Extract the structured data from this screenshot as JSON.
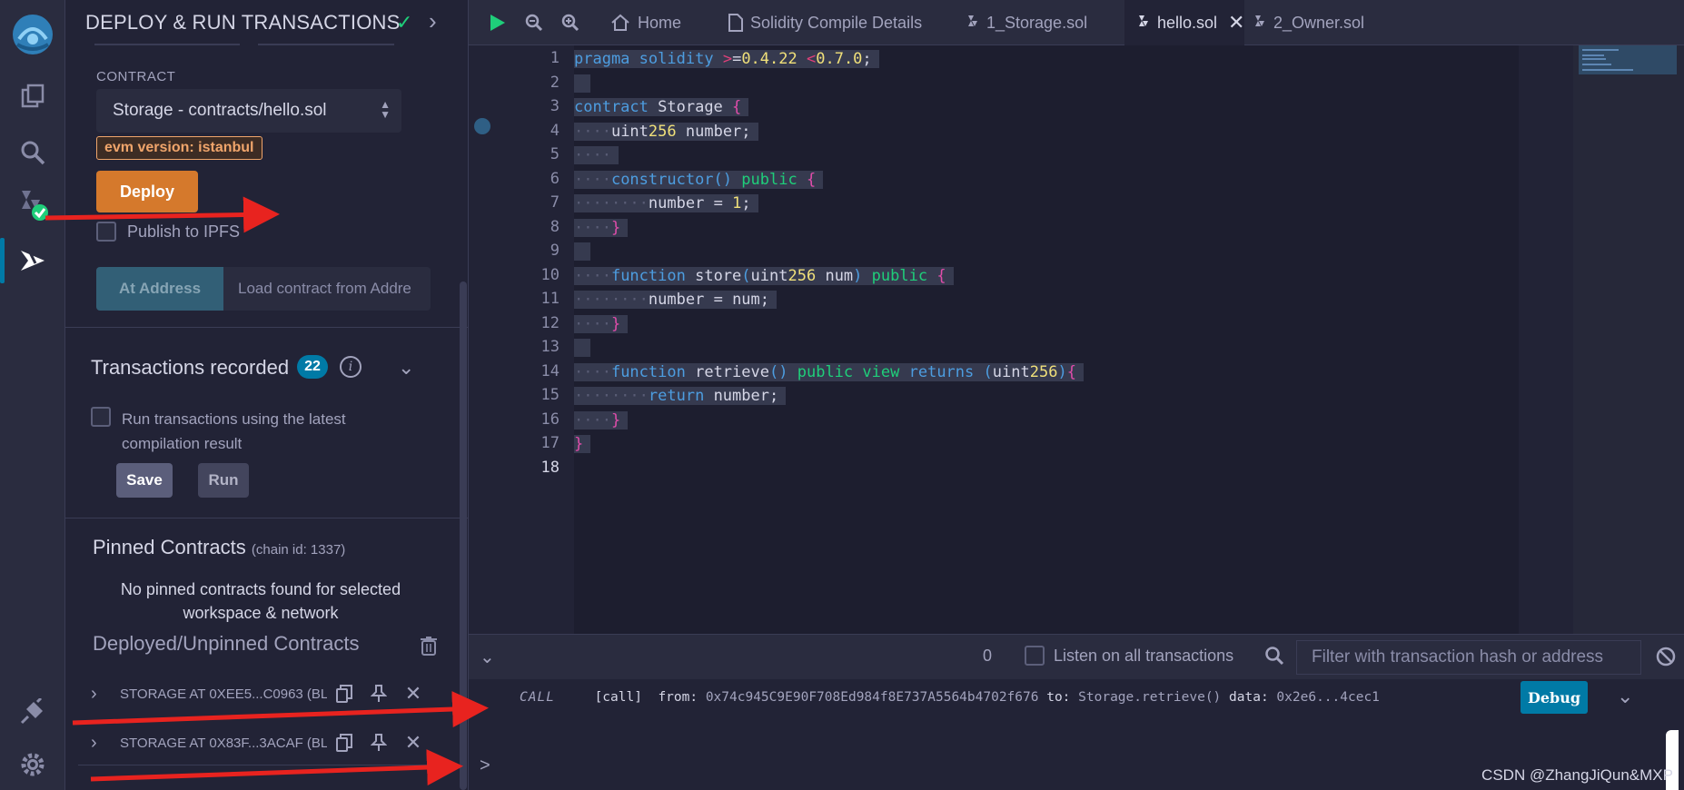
{
  "panel": {
    "title": "DEPLOY & RUN TRANSACTIONS",
    "contract_label": "CONTRACT",
    "contract_selected": "Storage - contracts/hello.sol",
    "evm_badge": "evm version: istanbul",
    "deploy_label": "Deploy",
    "publish_ipfs_label": "Publish to IPFS",
    "at_address_label": "At Address",
    "at_address_placeholder": "Load contract from Addre"
  },
  "transactions": {
    "title": "Transactions recorded",
    "count": "22",
    "run_latest_label_1": "Run transactions using the latest",
    "run_latest_label_2": "compilation result",
    "save_label": "Save",
    "run_label": "Run"
  },
  "pinned": {
    "title": "Pinned Contracts",
    "chain": "(chain id: 1337)",
    "empty_1": "No pinned contracts found for selected",
    "empty_2": "workspace & network"
  },
  "deployed": {
    "title": "Deployed/Unpinned Contracts",
    "items": [
      {
        "name": "STORAGE AT 0XEE5...C0963 (BL"
      },
      {
        "name": "STORAGE AT 0X83F...3ACAF (BL"
      }
    ]
  },
  "tabs": [
    {
      "label": "Home"
    },
    {
      "label": "Solidity Compile Details"
    },
    {
      "label": "1_Storage.sol"
    },
    {
      "label": "hello.sol"
    },
    {
      "label": "2_Owner.sol"
    }
  ],
  "editor": {
    "line_numbers": [
      "1",
      "2",
      "3",
      "4",
      "5",
      "6",
      "7",
      "8",
      "9",
      "10",
      "11",
      "12",
      "13",
      "14",
      "15",
      "16",
      "17",
      "18"
    ],
    "lines": [
      "pragma solidity >=0.4.22 <0.7.0;",
      "",
      "contract Storage {",
      "    uint256 number;",
      "    ",
      "    constructor() public {",
      "        number = 1;",
      "    }",
      "",
      "    function store(uint256 num) public {",
      "        number = num;",
      "    }",
      "",
      "    function retrieve() public view returns (uint256){",
      "        return number;",
      "    }",
      "}",
      ""
    ]
  },
  "terminal": {
    "pending_count": "0",
    "listen_label": "Listen on all transactions",
    "filter_placeholder": "Filter with transaction hash or address",
    "log": {
      "type": "CALL",
      "call": "[call]",
      "from_label": "from:",
      "from": "0x74c945C9E90F708Ed984f8E737A5564b4702f676",
      "to_label": "to:",
      "to": "Storage.retrieve()",
      "data_label": "data:",
      "data": "0x2e6...4cec1"
    },
    "debug_label": "Debug",
    "prompt": ">"
  },
  "watermark": "CSDN @ZhangJiQun&MXP",
  "colors": {
    "accent": "#007aa6",
    "deploy": "#d5792c",
    "success": "#1fce7a",
    "annotation_arrow": "#e8231f"
  }
}
